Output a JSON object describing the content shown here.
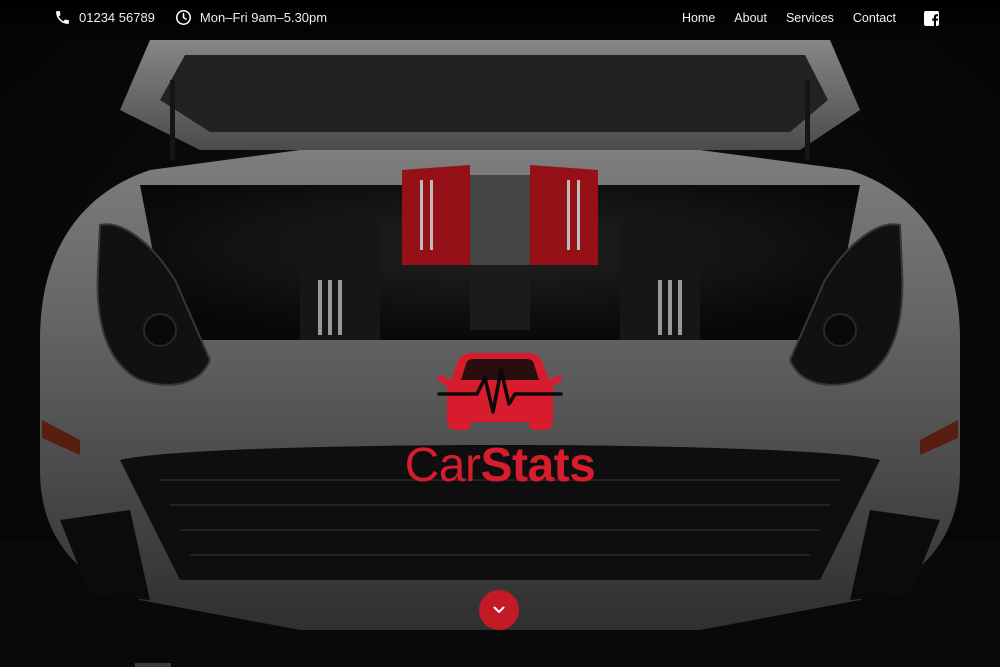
{
  "topbar": {
    "phone": "01234 56789",
    "hours": "Mon–Fri 9am–5.30pm",
    "icons": {
      "phone": "phone-icon",
      "hours": "clock-icon",
      "social": "facebook-icon"
    }
  },
  "nav": {
    "items": [
      {
        "label": "Home"
      },
      {
        "label": "About"
      },
      {
        "label": "Services"
      },
      {
        "label": "Contact"
      }
    ]
  },
  "hero": {
    "brand_part1": "Car",
    "brand_part2": "Stats",
    "logo_icon": "car-heartbeat-icon",
    "scroll_icon": "chevron-down-icon"
  },
  "colors": {
    "brand_red": "#d71d2d",
    "button_red": "#c41a26",
    "background": "#070707",
    "text": "#ffffff"
  }
}
